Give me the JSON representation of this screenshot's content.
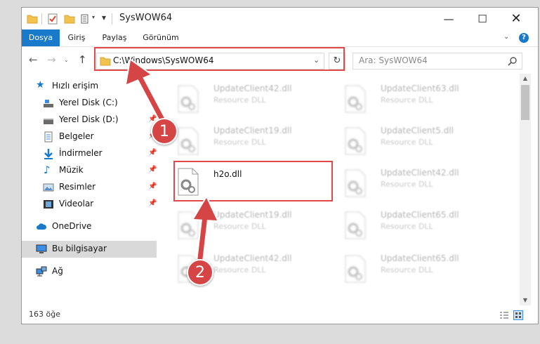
{
  "window": {
    "title": "SysWOW64"
  },
  "ribbon": {
    "tabs": [
      "Dosya",
      "Giriş",
      "Paylaş",
      "Görünüm"
    ],
    "help_icon": "?"
  },
  "address": {
    "path": "C:\\Windows\\SysWOW64"
  },
  "search": {
    "placeholder": "Ara: SysWOW64"
  },
  "sidebar": {
    "items": [
      {
        "label": "Hızlı erişim",
        "icon": "star-icon"
      },
      {
        "label": "Yerel Disk (C:)",
        "icon": "drive-icon"
      },
      {
        "label": "Yerel Disk (D:)",
        "icon": "drive-icon"
      },
      {
        "label": "Belgeler",
        "icon": "documents-icon"
      },
      {
        "label": "İndirmeler",
        "icon": "download-icon"
      },
      {
        "label": "Müzik",
        "icon": "music-icon"
      },
      {
        "label": "Resimler",
        "icon": "pictures-icon"
      },
      {
        "label": "Videolar",
        "icon": "video-icon"
      },
      {
        "label": "OneDrive",
        "icon": "cloud-icon"
      },
      {
        "label": "Bu bilgisayar",
        "icon": "computer-icon"
      },
      {
        "label": "Ağ",
        "icon": "network-icon"
      }
    ]
  },
  "files": {
    "left": [
      {
        "name": "UpdateClient42.dll",
        "desc": "Resource DLL"
      },
      {
        "name": "UpdateClient19.dll",
        "desc": "Resource DLL"
      },
      {
        "name": "h2o.dll",
        "desc": ""
      },
      {
        "name": "UpdateClient19.dll",
        "desc": "Resource DLL"
      },
      {
        "name": "UpdateClient42.dll",
        "desc": "Resource DLL"
      }
    ],
    "right": [
      {
        "name": "UpdateClient63.dll",
        "desc": "Resource DLL"
      },
      {
        "name": "UpdateClient5.dll",
        "desc": "Resource DLL"
      },
      {
        "name": "UpdateClient42.dll",
        "desc": "Resource DLL"
      },
      {
        "name": "UpdateClient65.dll",
        "desc": "Resource DLL"
      },
      {
        "name": "UpdateClient65.dll",
        "desc": "Resource DLL"
      }
    ]
  },
  "status": {
    "count": "163 öğe"
  },
  "annotations": {
    "step1": "1",
    "step2": "2"
  },
  "colors": {
    "accent": "#1979ca",
    "callout": "#e0484a"
  }
}
